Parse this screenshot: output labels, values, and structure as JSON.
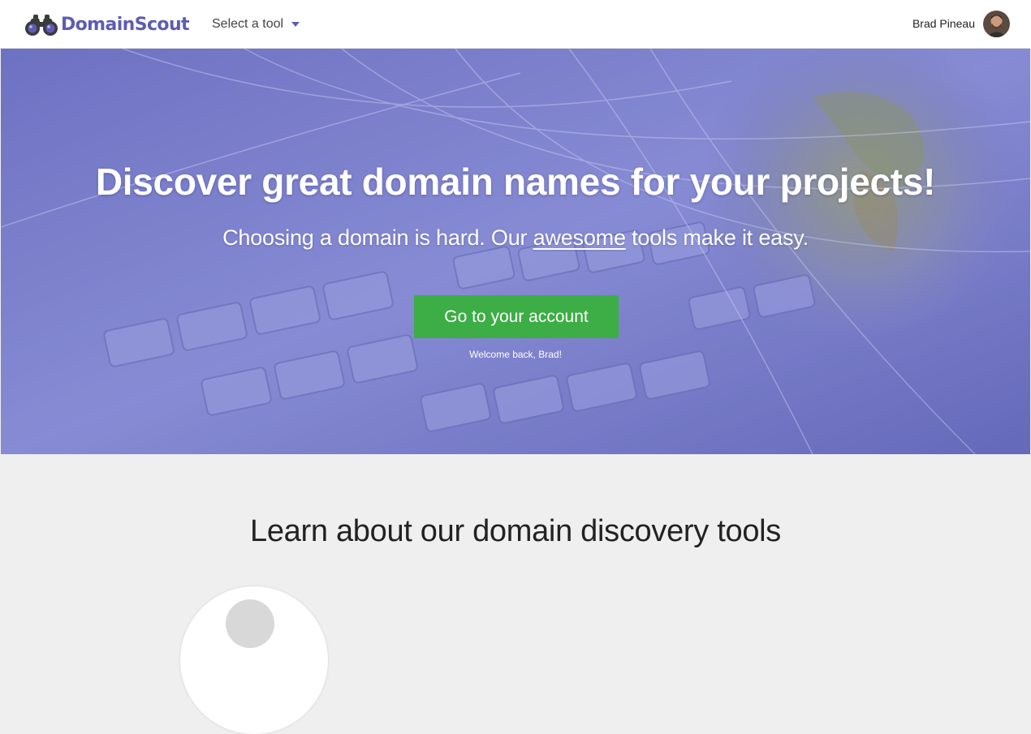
{
  "brand": {
    "name": "DomainScout",
    "icon": "binoculars-icon",
    "color": "#5d5cb3"
  },
  "nav": {
    "tool_select_label": "Select a tool",
    "caret_icon": "caret-down-icon"
  },
  "user": {
    "name": "Brad Pineau",
    "avatar_icon": "avatar-photo"
  },
  "hero": {
    "title": "Discover great domain names for your projects!",
    "subtitle_before": "Choosing a domain is hard. Our ",
    "subtitle_link": "awesome",
    "subtitle_after": " tools make it easy.",
    "cta_label": "Go to your account",
    "cta_color": "#3dad45",
    "welcome": "Welcome back, Brad!",
    "background_icon": "keyboard-globe-background"
  },
  "tools_section": {
    "title": "Learn about our domain discovery tools"
  }
}
